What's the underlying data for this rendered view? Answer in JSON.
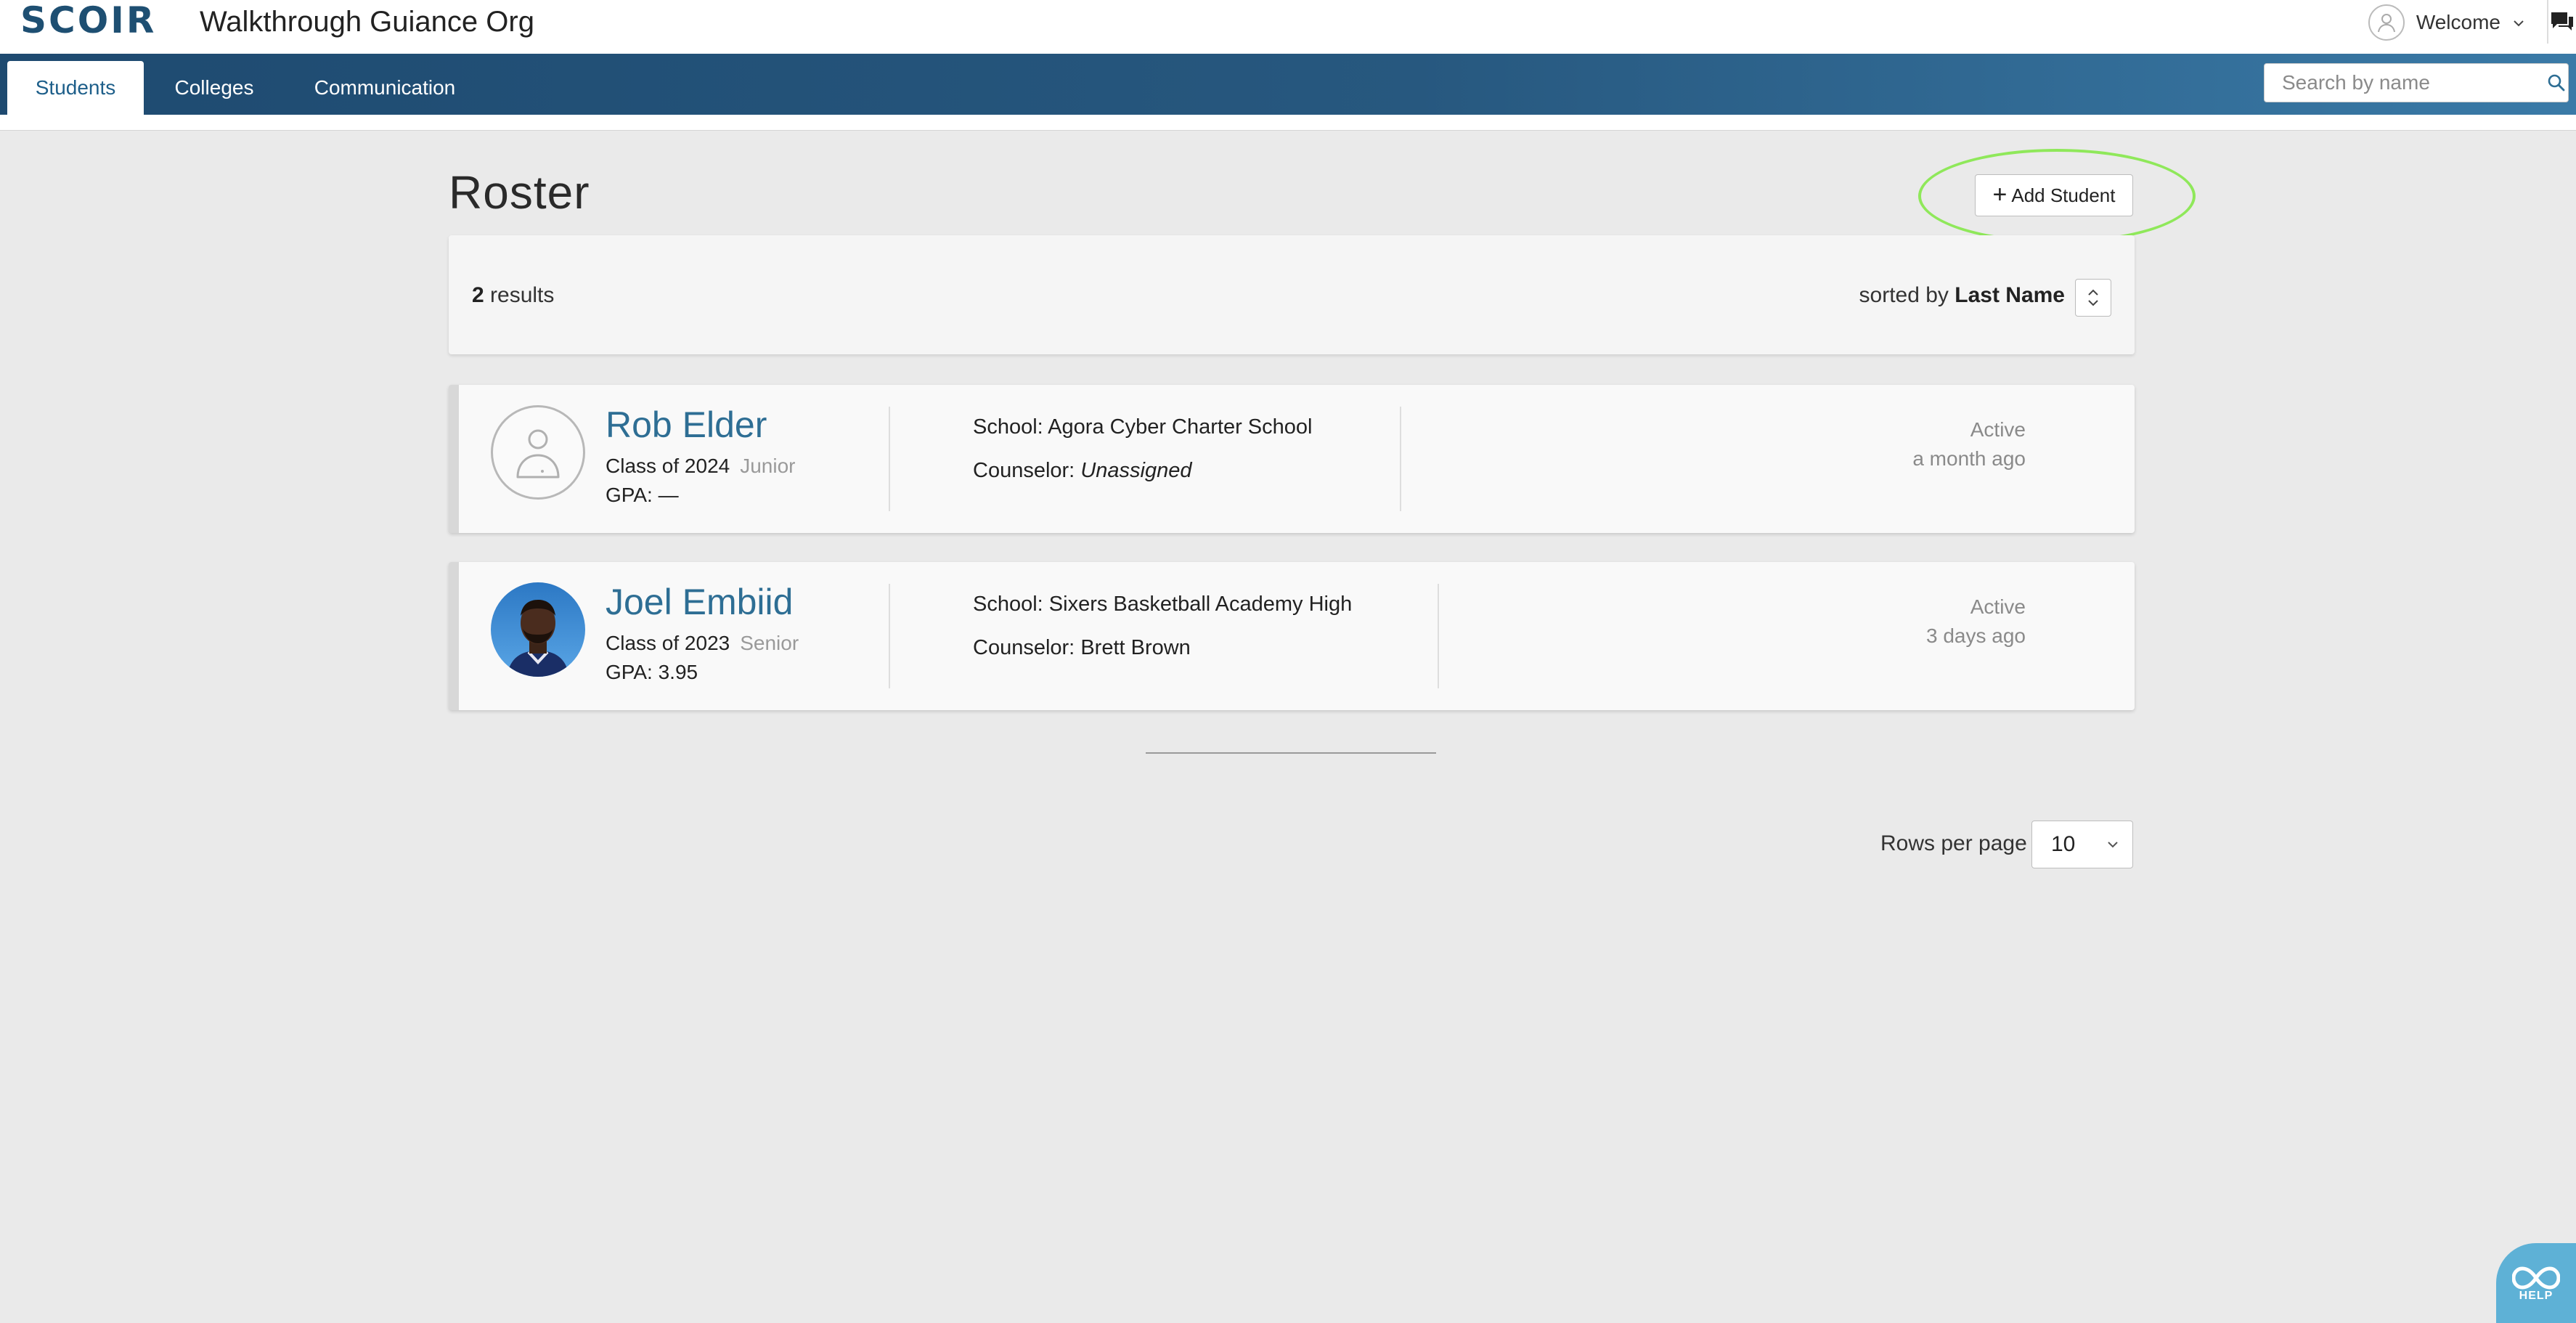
{
  "header": {
    "logo_text": "SCOIR",
    "org_title": "Walkthrough Guiance Org",
    "welcome_label": "Welcome"
  },
  "nav": {
    "tabs": [
      {
        "label": "Students",
        "active": true
      },
      {
        "label": "Colleges",
        "active": false
      },
      {
        "label": "Communication",
        "active": false
      }
    ],
    "search_placeholder": "Search by name"
  },
  "roster": {
    "title": "Roster",
    "add_button_label": "Add Student",
    "results_count": "2",
    "results_word": "results",
    "sorted_by_prefix": "sorted by",
    "sorted_by_field": "Last Name"
  },
  "students": [
    {
      "name": "Rob Elder",
      "class_of": "Class of 2024",
      "grade": "Junior",
      "gpa": "GPA: —",
      "school": "School: Agora Cyber Charter School",
      "counselor_prefix": "Counselor:",
      "counselor": "Unassigned",
      "counselor_italic": true,
      "status": "Active",
      "last_active": "a month ago"
    },
    {
      "name": "Joel Embiid",
      "class_of": "Class of 2023",
      "grade": "Senior",
      "gpa": "GPA: 3.95",
      "school": "School: Sixers Basketball Academy High",
      "counselor_prefix": "Counselor:",
      "counselor": "Brett Brown",
      "counselor_italic": false,
      "status": "Active",
      "last_active": "3 days ago"
    }
  ],
  "pagination": {
    "rows_per_page_label": "Rows per page",
    "rows_per_page_value": "10"
  },
  "help": {
    "label": "HELP"
  },
  "colors": {
    "brand_dark": "#1e4a70",
    "link_blue": "#2e6e94",
    "highlight_green": "#8fe85a",
    "help_blue": "#5eb1d6"
  }
}
